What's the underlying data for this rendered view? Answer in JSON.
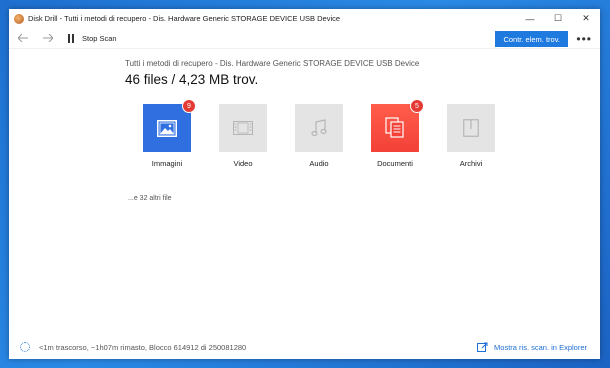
{
  "window": {
    "title": "Disk Drill - Tutti i metodi di recupero - Dis. Hardware Generic STORAGE DEVICE USB Device",
    "controls": {
      "minimize": "—",
      "maximize": "☐",
      "close": "✕"
    }
  },
  "toolbar": {
    "back_icon": "arrow-left-icon",
    "forward_icon": "arrow-right-icon",
    "stop_label": "Stop Scan",
    "primary_label": "Contr. elem. trov.",
    "more_label": "•••"
  },
  "header": {
    "subtitle": "Tutti i metodi di recupero - Dis. Hardware Generic STORAGE DEVICE USB Device",
    "headline": "46 files / 4,23 MB trov."
  },
  "categories": [
    {
      "label": "Immagini",
      "badge": "9",
      "icon": "image-icon",
      "active": true,
      "color": "#2f6fe0"
    },
    {
      "label": "Video",
      "badge": "",
      "icon": "film-icon",
      "active": false
    },
    {
      "label": "Audio",
      "badge": "",
      "icon": "music-note-icon",
      "active": false
    },
    {
      "label": "Documenti",
      "badge": "5",
      "icon": "documents-icon",
      "active": true,
      "color": "#f34138"
    },
    {
      "label": "Archivi",
      "badge": "",
      "icon": "archive-icon",
      "active": false
    }
  ],
  "more_files": "...e 32 altri file",
  "status": {
    "progress_text": "<1m trascorso, ~1h07m rimasto, Blocco 614912 di 250081280",
    "explorer_link": "Mostra ris. scan. in Explorer"
  },
  "colors": {
    "accent": "#1f7ae0",
    "badge": "#e53b35",
    "desktop": "#2a8ae6"
  }
}
